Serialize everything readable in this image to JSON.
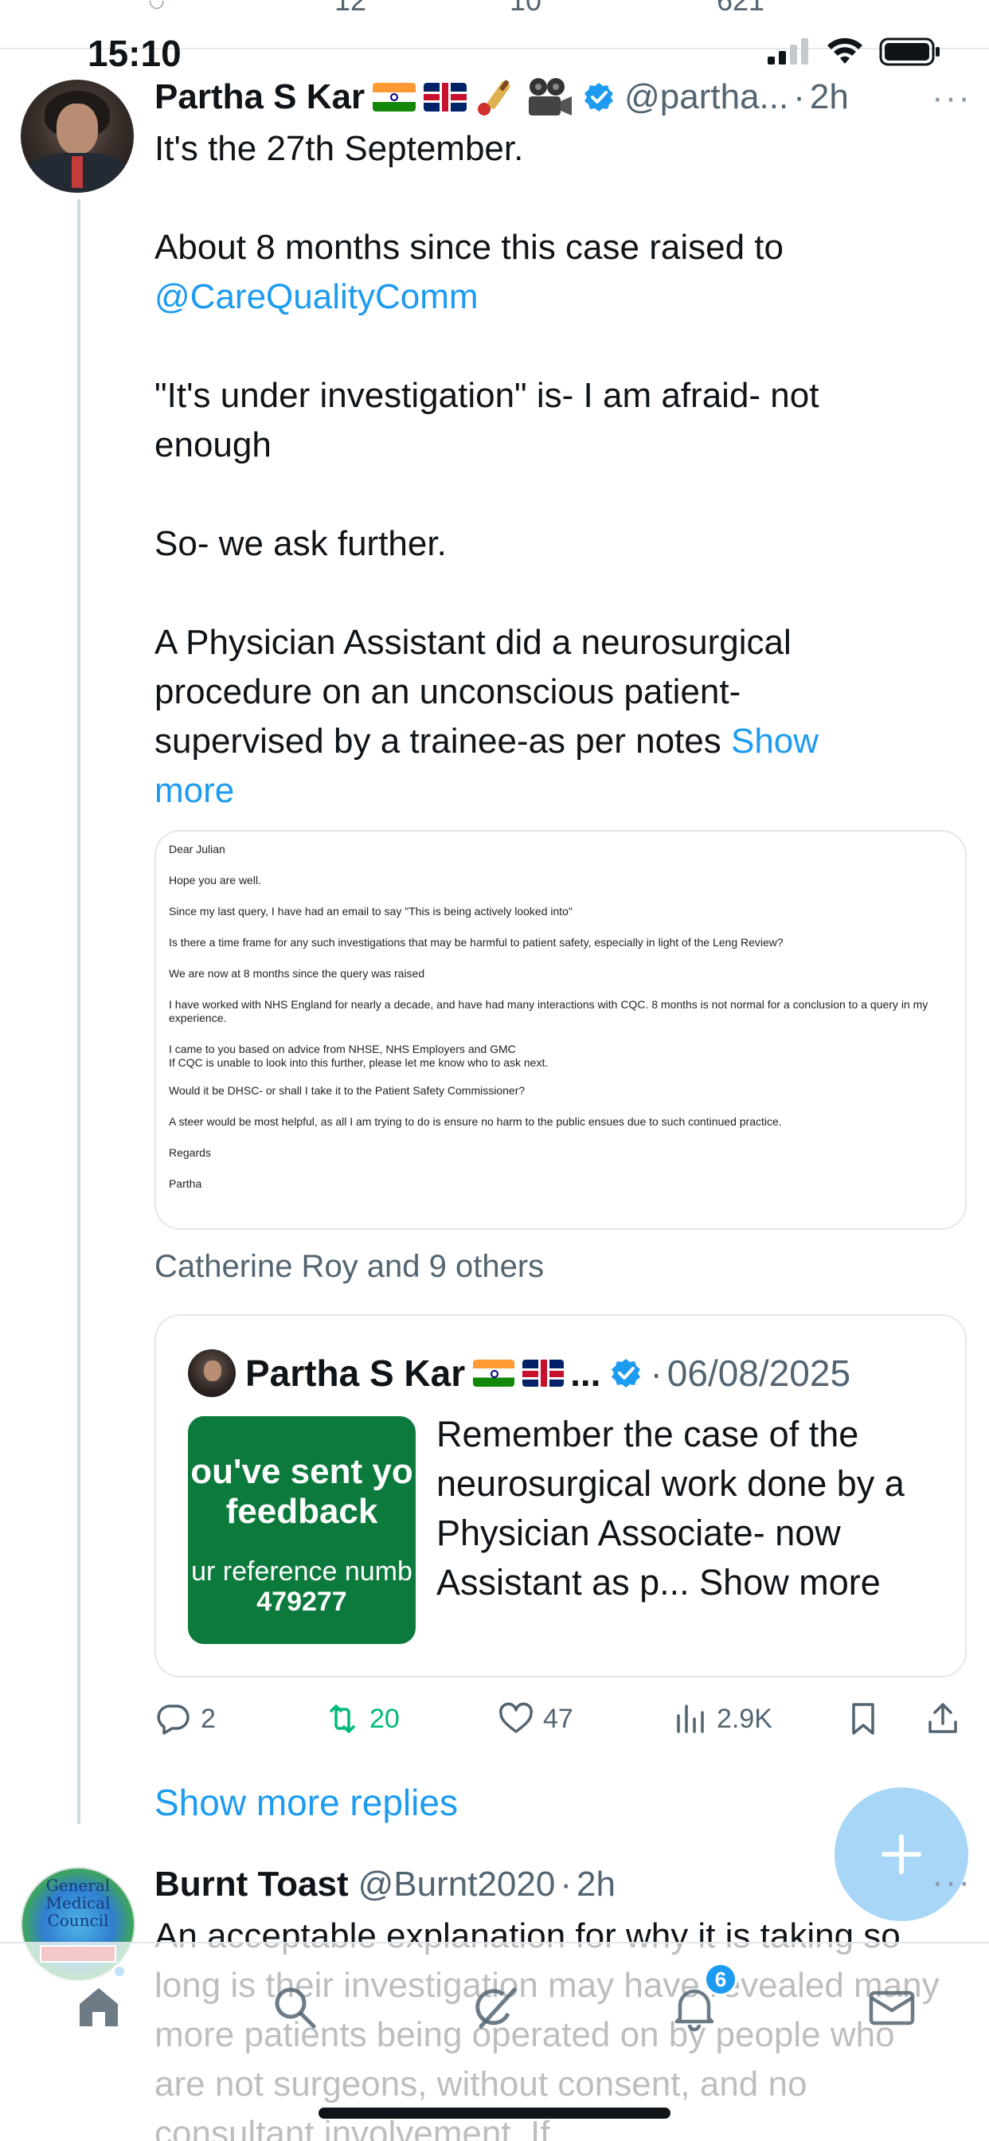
{
  "status_bar": {
    "time": "15:10"
  },
  "previous_tweet_fragments": {
    "reposts": "12",
    "likes": "10",
    "views": "621"
  },
  "tweet": {
    "author_name": "Partha S Kar",
    "handle": "@partha...",
    "separator": "·",
    "time": "2h",
    "more": "···",
    "emojis": [
      "flag-india-icon",
      "flag-uk-icon",
      "cricket-icon",
      "movie-camera-icon",
      "verified-badge-icon"
    ],
    "text": {
      "p1": "It's the 27th September.",
      "p2_prefix": "About 8 months since this case raised to",
      "p2_mention": "@CareQualityComm",
      "p3": "\"It's under investigation\" is- I am afraid- not enough",
      "p4": "So- we ask further.",
      "p5": "A Physician Assistant did a neurosurgical procedure on an unconscious patient- supervised by a trainee-as per notes",
      "show_more": "Show more"
    },
    "letter": {
      "l1": "Dear Julian",
      "l2": "Hope you are well.",
      "l3": "Since my last query, I have had an email to say \"This is being actively looked into\"",
      "l4": "Is there a time frame for any such investigations that may be harmful to patient safety, especially in light of the Leng Review?",
      "l5": "We are now at 8 months since the query was raised",
      "l6": "I have worked with NHS England for nearly a decade, and have had many interactions with CQC. 8 months is not normal for a conclusion to a query in my experience.",
      "l7a": "I came to you based on advice from NHSE, NHS Employers and GMC",
      "l7b": "If CQC is unable to look into this further, please let me know who to ask next.",
      "l8": "Would it be DHSC- or shall I take it to the Patient Safety Commissioner?",
      "l9": "A steer would be most helpful, as all I am trying to do is ensure no harm to the public ensues due to such continued practice.",
      "l10": "Regards",
      "l11": "Partha"
    },
    "liked_by": "Catherine Roy and 9 others",
    "quote": {
      "author_name": "Partha S Kar",
      "ellipsis": "...",
      "separator": "·",
      "date": "06/08/2025",
      "thumb": {
        "line1": "ou've sent yo",
        "line2": "feedback",
        "line3": "ur reference numb",
        "line4": "479277",
        "bg_color": "#0d7a3d"
      },
      "text": "Remember the case of the neurosurgical work done by a Physician Associate- now Assistant as p...",
      "show_more": "Show more"
    },
    "actions": {
      "replies": "2",
      "reposts": "20",
      "likes": "47",
      "views": "2.9K"
    }
  },
  "show_more_replies": "Show more replies",
  "reply": {
    "author_name": "Burnt Toast",
    "handle": "@Burnt2020",
    "separator": "·",
    "time": "2h",
    "more": "···",
    "avatar_text": "General Medical Council",
    "text": "An acceptable explanation for why it is taking so long is their investigation may have revealed many more patients being operated on by people who are not surgeons, without consent, and no consultant involvement. If"
  },
  "tab_bar": {
    "notification_badge": "6",
    "tabs": [
      "home-icon",
      "search-icon",
      "grok-icon",
      "bell-icon",
      "mail-icon"
    ]
  },
  "colors": {
    "accent": "#1d9bf0",
    "repost_active": "#00ba7c",
    "secondary_text": "#536471",
    "fab": "#a8d6f7"
  }
}
